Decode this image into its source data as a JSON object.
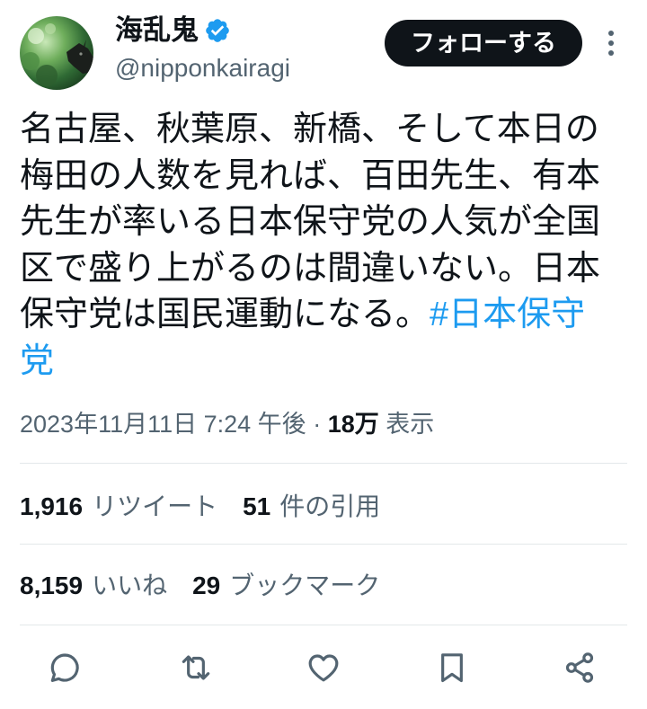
{
  "author": {
    "name": "海乱鬼",
    "handle": "@nipponkairagi",
    "verified": true,
    "avatar_icon": "avatar",
    "badge_icon": "verified-badge-icon"
  },
  "follow_button": {
    "label": "フォローする"
  },
  "more_icon": "more-vertical-icon",
  "tweet": {
    "text": "名古屋、秋葉原、新橋、そして本日の梅田の人数を見れば、百田先生、有本先生が率いる日本保守党の人気が全国区で盛り上がるのは間違いない。日本保守党は国民運動になる。",
    "hashtag": "#日本保守党"
  },
  "meta": {
    "timestamp": "2023年11月11日 7:24 午後",
    "separator": "·",
    "views_count": "18万",
    "views_label": "表示"
  },
  "stats": {
    "retweets": {
      "count": "1,916",
      "label": "リツイート"
    },
    "quotes": {
      "count": "51",
      "label": "件の引用"
    },
    "likes": {
      "count": "8,159",
      "label": "いいね"
    },
    "bookmarks": {
      "count": "29",
      "label": "ブックマーク"
    }
  },
  "actions": [
    {
      "name": "reply",
      "icon": "reply-icon"
    },
    {
      "name": "retweet",
      "icon": "retweet-icon"
    },
    {
      "name": "like",
      "icon": "heart-icon"
    },
    {
      "name": "bookmark",
      "icon": "bookmark-icon"
    },
    {
      "name": "share",
      "icon": "share-icon"
    }
  ],
  "colors": {
    "text": "#0f1419",
    "secondary": "#536471",
    "link": "#1d9bf0",
    "verified": "#1d9bf0",
    "follow_bg": "#0f1419",
    "divider": "#e3e8ea"
  }
}
